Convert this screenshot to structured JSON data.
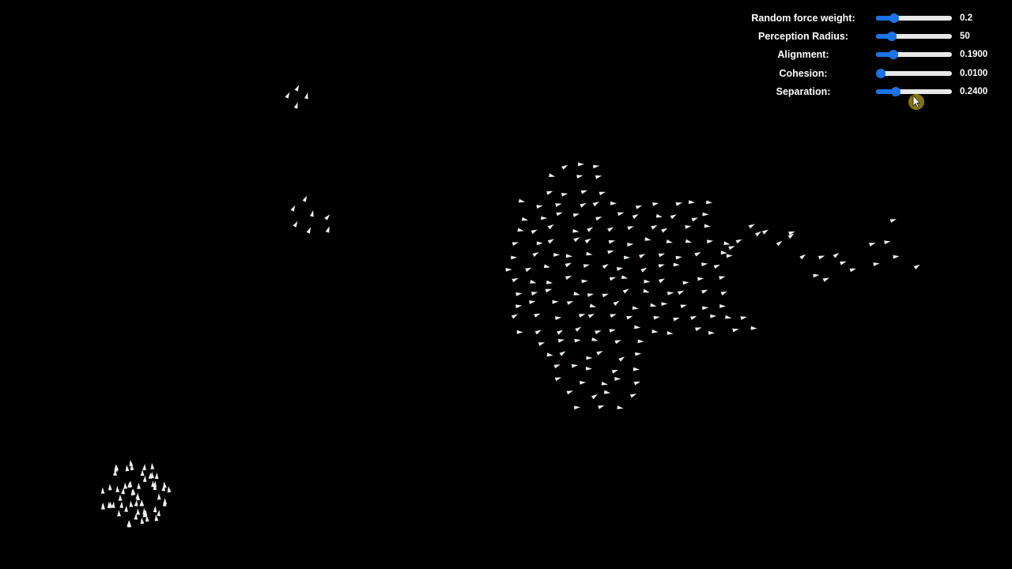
{
  "controls": [
    {
      "id": "random-force-weight",
      "label": "Random force weight:",
      "value": "0.2",
      "level": 0.24
    },
    {
      "id": "perception-radius",
      "label": "Perception Radius:",
      "value": "50",
      "level": 0.21
    },
    {
      "id": "alignment",
      "label": "Alignment:",
      "value": "0.1900",
      "level": 0.23
    },
    {
      "id": "cohesion",
      "label": "Cohesion:",
      "value": "0.0100",
      "level": 0.06
    },
    {
      "id": "separation",
      "label": "Separation:",
      "value": "0.2400",
      "level": 0.26
    }
  ],
  "colors": {
    "background": "#000000",
    "boid": "#e8f2ee",
    "slider_fill": "#1a73e8",
    "slider_track": "#e8e8e8",
    "cursor_highlight": "#9a8a10"
  },
  "icons": {
    "boid": "triangle-icon",
    "cursor": "mouse-pointer-icon"
  }
}
